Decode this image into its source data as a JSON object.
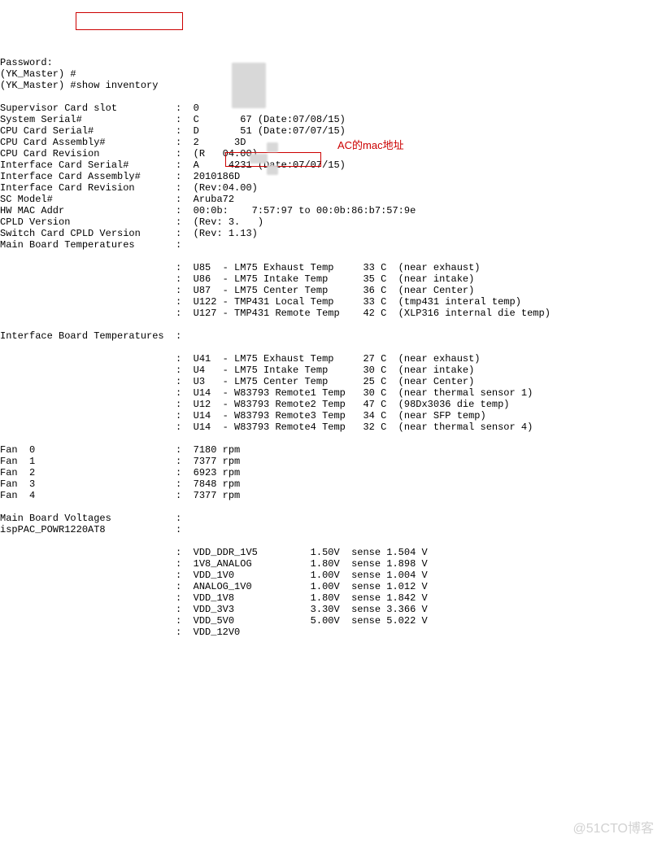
{
  "prompt": {
    "line0": "Password:",
    "line1": "(YK_Master) #",
    "line2_prefix": "(YK_Master) ",
    "line2_cmd": "#show inventory"
  },
  "kv": {
    "supervisor_slot": {
      "label": "Supervisor Card slot",
      "value": "0"
    },
    "system_serial": {
      "label": "System Serial#",
      "value": "C       67 (Date:07/08/15)"
    },
    "cpu_serial": {
      "label": "CPU Card Serial#",
      "value": "D       51 (Date:07/07/15)"
    },
    "cpu_assembly": {
      "label": "CPU Card Assembly#",
      "value": "2      3D"
    },
    "cpu_rev": {
      "label": "CPU Card Revision",
      "value": "(R   04.00)"
    },
    "if_serial": {
      "label": "Interface Card Serial#",
      "value": "A     4231 (Date:07/07/15)"
    },
    "if_assembly": {
      "label": "Interface Card Assembly#",
      "value": "2010186D"
    },
    "if_rev": {
      "label": "Interface Card Revision",
      "value": "(Rev:04.00)"
    },
    "sc_model": {
      "label": "SC Model#",
      "value": "Aruba72"
    },
    "mac": {
      "label": "HW MAC Addr",
      "value": "00:0b:    7:57:97",
      "tail": " to 00:0b:86:b7:57:9e"
    },
    "cpld": {
      "label": "CPLD Version",
      "value": "(Rev: 3.   )"
    },
    "sw_cpld": {
      "label": "Switch Card CPLD Version",
      "value": "(Rev: 1.13)"
    },
    "mb_temp_header": {
      "label": "Main Board Temperatures",
      "value": ""
    }
  },
  "mb_temps": [
    {
      "id": "U85 ",
      "name": "- LM75 Exhaust Temp",
      "val": "33 C",
      "note": "(near exhaust)"
    },
    {
      "id": "U86 ",
      "name": "- LM75 Intake Temp",
      "val": "35 C",
      "note": "(near intake)"
    },
    {
      "id": "U87 ",
      "name": "- LM75 Center Temp",
      "val": "36 C",
      "note": "(near Center)"
    },
    {
      "id": "U122",
      "name": "- TMP431 Local Temp",
      "val": "33 C",
      "note": "(tmp431 interal temp)"
    },
    {
      "id": "U127",
      "name": "- TMP431 Remote Temp",
      "val": "42 C",
      "note": "(XLP316 internal die temp)"
    }
  ],
  "if_temp_header": {
    "label": "Interface Board Temperatures",
    "value": ""
  },
  "if_temps": [
    {
      "id": "U41 ",
      "name": "- LM75 Exhaust Temp",
      "val": "27 C",
      "note": "(near exhaust)"
    },
    {
      "id": "U4  ",
      "name": "- LM75 Intake Temp",
      "val": "30 C",
      "note": "(near intake)"
    },
    {
      "id": "U3  ",
      "name": "- LM75 Center Temp",
      "val": "25 C",
      "note": "(near Center)"
    },
    {
      "id": "U14 ",
      "name": "- W83793 Remote1 Temp",
      "val": "30 C",
      "note": "(near thermal sensor 1)"
    },
    {
      "id": "U12 ",
      "name": "- W83793 Remote2 Temp",
      "val": "47 C",
      "note": "(98Dx3036 die temp)"
    },
    {
      "id": "U14 ",
      "name": "- W83793 Remote3 Temp",
      "val": "34 C",
      "note": "(near SFP temp)"
    },
    {
      "id": "U14 ",
      "name": "- W83793 Remote4 Temp",
      "val": "32 C",
      "note": "(near thermal sensor 4)"
    }
  ],
  "fans": [
    {
      "label": "Fan  0",
      "value": "7180 rpm"
    },
    {
      "label": "Fan  1",
      "value": "7377 rpm"
    },
    {
      "label": "Fan  2",
      "value": "6923 rpm"
    },
    {
      "label": "Fan  3",
      "value": "7848 rpm"
    },
    {
      "label": "Fan  4",
      "value": "7377 rpm"
    }
  ],
  "voltage_header": {
    "label": "Main Board Voltages",
    "value": ""
  },
  "isppac": {
    "label": "ispPAC_POWR1220AT8",
    "value": ""
  },
  "volts": [
    {
      "name": "VDD_DDR_1V5",
      "expected": "1.50V",
      "sensed": "sense 1.504 V"
    },
    {
      "name": "1V8_ANALOG",
      "expected": "1.80V",
      "sensed": "sense 1.898 V"
    },
    {
      "name": "VDD_1V0",
      "expected": "1.00V",
      "sensed": "sense 1.004 V"
    },
    {
      "name": "ANALOG_1V0",
      "expected": "1.00V",
      "sensed": "sense 1.012 V"
    },
    {
      "name": "VDD_1V8",
      "expected": "1.80V",
      "sensed": "sense 1.842 V"
    },
    {
      "name": "VDD_3V3",
      "expected": "3.30V",
      "sensed": "sense 3.366 V"
    },
    {
      "name": "VDD_5V0",
      "expected": "5.00V",
      "sensed": "sense 5.022 V"
    },
    {
      "name": "VDD_12V0",
      "expected": "",
      "sensed": ""
    }
  ],
  "annotation": {
    "mac_label": "AC的mac地址"
  },
  "watermark": "@51CTO博客"
}
